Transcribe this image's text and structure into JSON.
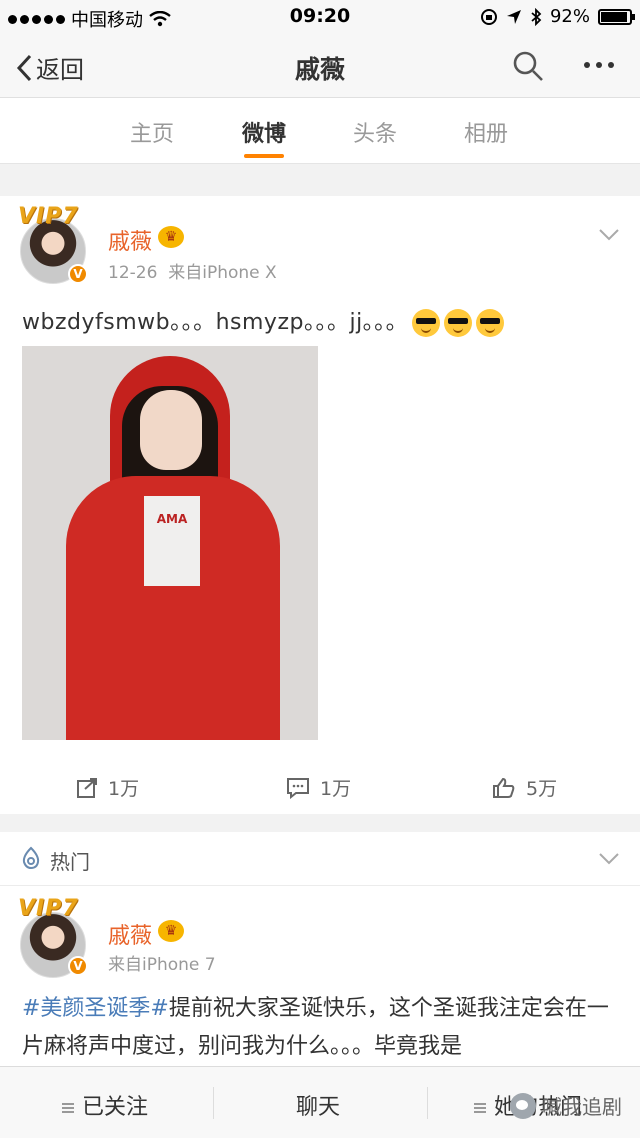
{
  "status_bar": {
    "carrier": "中国移动",
    "time": "09:20",
    "battery_percent": "92%"
  },
  "nav": {
    "back_label": "返回",
    "title": "戚薇"
  },
  "tabs": [
    {
      "label": "主页"
    },
    {
      "label": "微博"
    },
    {
      "label": "头条"
    },
    {
      "label": "相册"
    }
  ],
  "post": {
    "vip_label": "VIP7",
    "badge": "V",
    "username": "戚薇",
    "date": "12-26",
    "source": "来自iPhone X",
    "text": "wbzdyfsmwb。。。hsmyzp。。。jj。。。",
    "photo_caption": "AMA",
    "actions": {
      "repost": "1万",
      "comment": "1万",
      "like": "5万"
    }
  },
  "hot": {
    "label": "热门",
    "vip_label": "VIP7",
    "badge": "V",
    "username": "戚薇",
    "source": "来自iPhone 7",
    "topic": "#美颜圣诞季#",
    "text": "提前祝大家圣诞快乐，这个圣诞我注定会在一片麻将声中度过，别问我为什么。。。毕竟我是"
  },
  "bottom_bar": {
    "follow": "已关注",
    "chat": "聊天",
    "her_hot": "她的热门"
  },
  "watermark": "喊我追剧",
  "colors": {
    "accent": "#ff8200",
    "username": "#e8632a",
    "topic": "#4a7cb8"
  }
}
